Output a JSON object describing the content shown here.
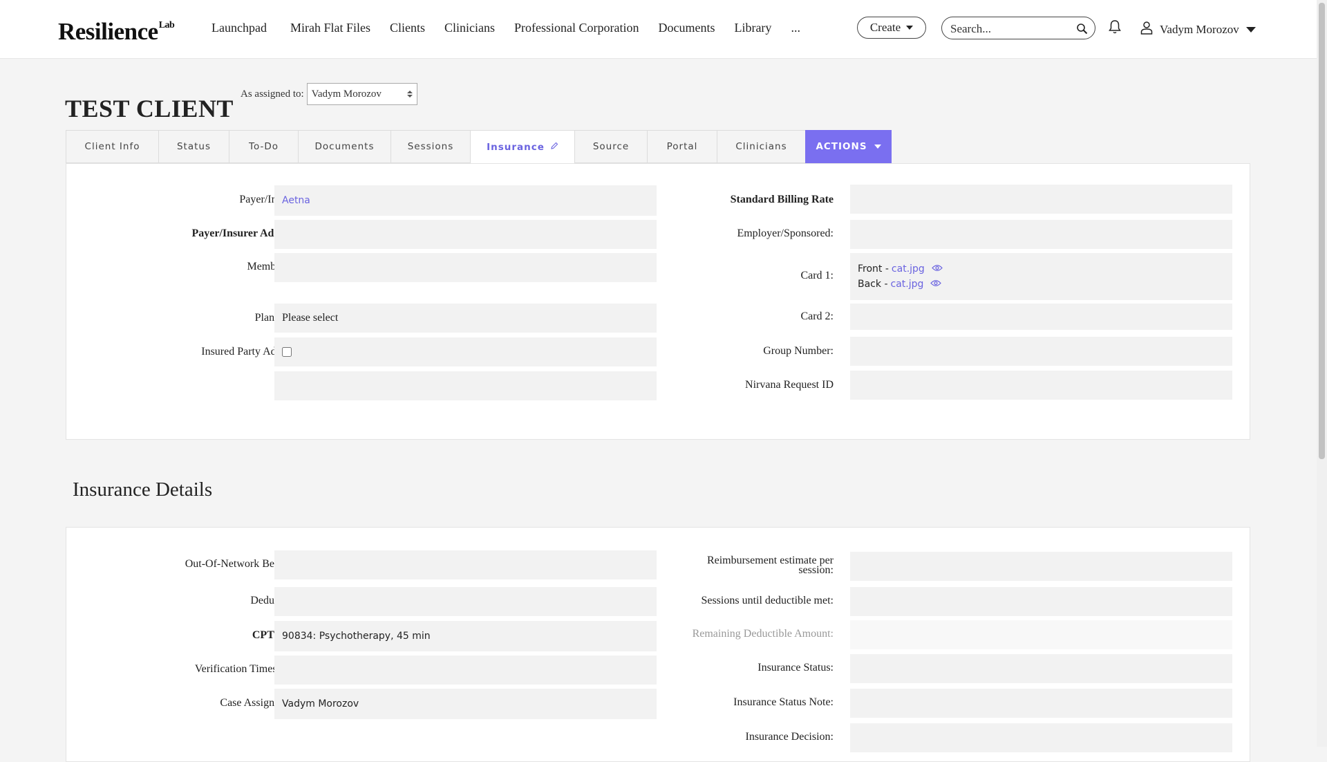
{
  "brand": {
    "name": "Resilience",
    "sup": "Lab"
  },
  "nav": {
    "links": [
      "Launchpad",
      "Mirah Flat Files",
      "Clients",
      "Clinicians",
      "Professional Corporation",
      "Documents",
      "Library",
      "..."
    ],
    "create_label": "Create",
    "search_placeholder": "Search...",
    "user_name": "Vadym Morozov"
  },
  "client": {
    "title": "TEST CLIENT",
    "assigned_label": "As assigned to:",
    "assigned_value": "Vadym Morozov"
  },
  "tabs": [
    "Client Info",
    "Status",
    "To-Do",
    "Documents",
    "Sessions",
    "Insurance",
    "Source",
    "Portal",
    "Clinicians",
    "ACTIONS"
  ],
  "active_tab": "Insurance",
  "insurance": {
    "left": [
      {
        "label": "Payer/Insurer:",
        "value": ""
      },
      {
        "label": "Payer/Insurer Address:",
        "value": ""
      },
      {
        "label": "Member ID:",
        "value": ""
      },
      {
        "label": "Plan Type:",
        "value": "Please select"
      },
      {
        "label": "Insured Party Address:",
        "value": ""
      }
    ],
    "payer_value": "Aetna",
    "right": [
      {
        "label": "Standard Billing Rate",
        "value": ""
      },
      {
        "label": "Employer/Sponsored:",
        "value": ""
      },
      {
        "label": "Card 1:",
        "value": ""
      },
      {
        "label": "Card 2:",
        "value": ""
      },
      {
        "label": "Group Number:",
        "value": ""
      },
      {
        "label": "Nirvana Request ID",
        "value": ""
      }
    ],
    "card1": {
      "front_label": "Front -",
      "front_file": "cat.jpg",
      "back_label": "Back -",
      "back_file": "cat.jpg"
    }
  },
  "details": {
    "title": "Insurance Details",
    "left": [
      {
        "label": "Out-Of-Network Benefits:",
        "value": ""
      },
      {
        "label": "Deductible:",
        "value": ""
      },
      {
        "label": "CPT code:",
        "value": "90834: Psychotherapy, 45 min"
      },
      {
        "label": "Verification Timestamp:",
        "value": ""
      },
      {
        "label": "Case Assigned To:",
        "value": "Vadym Morozov"
      }
    ],
    "right": [
      {
        "label": "Reimbursement estimate per session:",
        "value": ""
      },
      {
        "label": "Sessions until deductible met:",
        "value": ""
      },
      {
        "label": "Remaining Deductible Amount:",
        "value": ""
      },
      {
        "label": "Insurance Status:",
        "value": ""
      },
      {
        "label": "Insurance Status Note:",
        "value": ""
      },
      {
        "label": "Insurance Decision:",
        "value": ""
      }
    ]
  },
  "colors": {
    "accent": "#6a63e0",
    "actions_bg": "#7a6ff0",
    "page_bg": "#f4f4f4",
    "field_bg": "#f2f2f2"
  }
}
